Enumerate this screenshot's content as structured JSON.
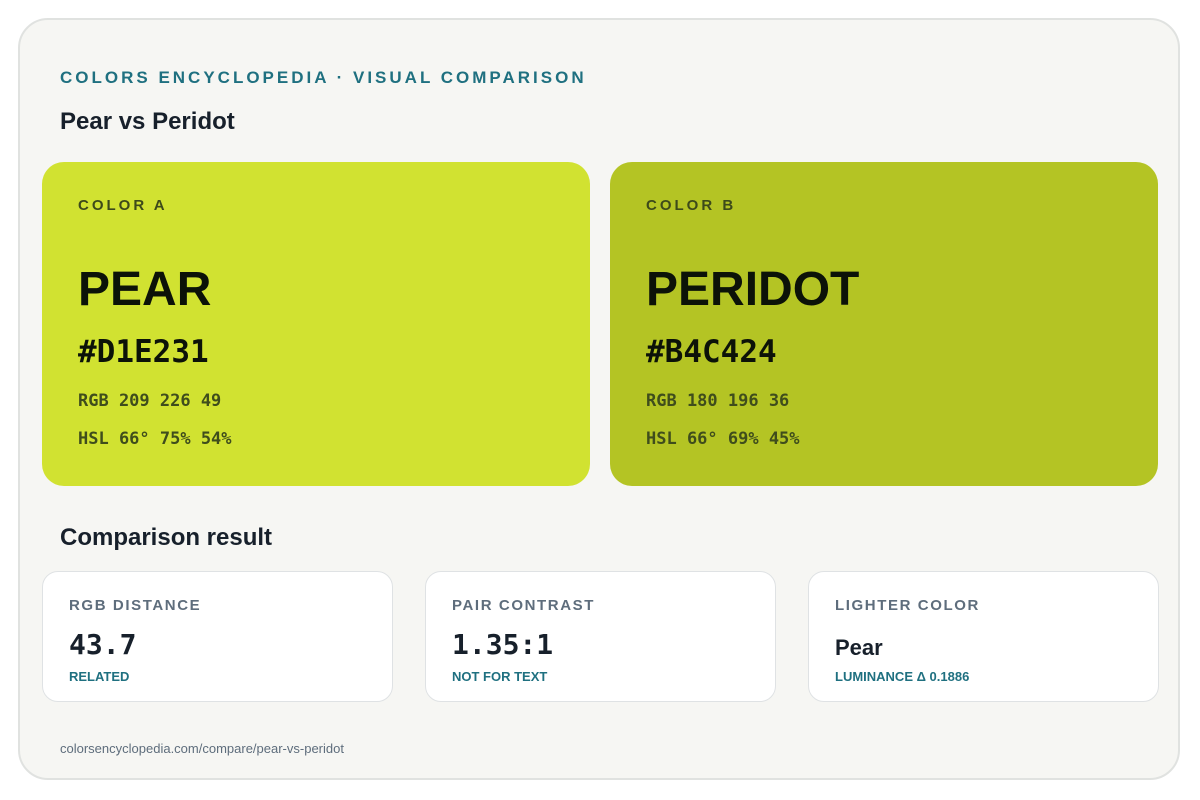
{
  "header": {
    "eyebrow": "COLORS ENCYCLOPEDIA · VISUAL COMPARISON",
    "title": "Pear vs Peridot"
  },
  "colors": [
    {
      "label": "COLOR A",
      "name": "PEAR",
      "hex": "#D1E231",
      "rgb": "RGB 209 226 49",
      "hsl": "HSL 66° 75% 54%",
      "swatch_color": "#D1E231"
    },
    {
      "label": "COLOR B",
      "name": "PERIDOT",
      "hex": "#B4C424",
      "rgb": "RGB 180 196 36",
      "hsl": "HSL 66° 69% 45%",
      "swatch_color": "#B4C424"
    }
  ],
  "comparison": {
    "title": "Comparison result",
    "metrics": [
      {
        "label": "RGB DISTANCE",
        "value": "43.7",
        "note": "RELATED"
      },
      {
        "label": "PAIR CONTRAST",
        "value": "1.35:1",
        "note": "NOT FOR TEXT"
      },
      {
        "label": "LIGHTER COLOR",
        "value": "Pear",
        "note": "LUMINANCE Δ 0.1886"
      }
    ]
  },
  "footer": {
    "url": "colorsencyclopedia.com/compare/pear-vs-peridot"
  },
  "theme": {
    "accent": "#1F7080",
    "background": "#F6F6F3",
    "card_border": "#E0E2E0"
  }
}
